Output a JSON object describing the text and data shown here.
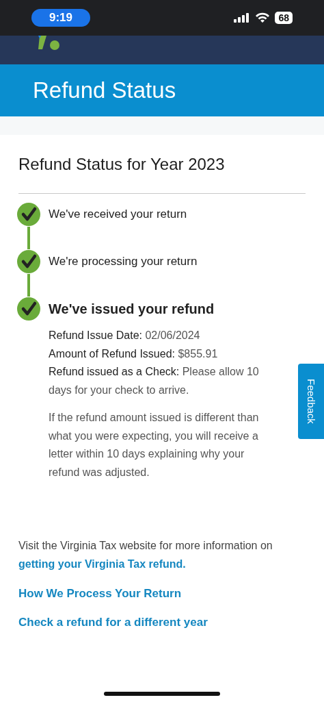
{
  "status_bar": {
    "time": "9:19",
    "battery": "68"
  },
  "page_title": "Refund Status",
  "heading": "Refund Status for Year 2023",
  "steps": [
    {
      "label": "We've received your return",
      "completed": true,
      "current": false
    },
    {
      "label": "We're processing your return",
      "completed": true,
      "current": false
    },
    {
      "label": "We've issued your refund",
      "completed": true,
      "current": true
    }
  ],
  "details": [
    {
      "label": "Refund Issue Date:",
      "value": "02/06/2024"
    },
    {
      "label": "Amount of Refund Issued:",
      "value": "$855.91"
    },
    {
      "label": "Refund issued as a Check:",
      "value": "Please allow 10 days for your check to arrive."
    }
  ],
  "note": "If the refund amount issued is different than what you were expecting, you will receive a letter within 10 days explaining why your refund was adjusted.",
  "info": {
    "text": "Visit the Virginia Tax website for more information on",
    "link": "getting your Virginia Tax refund."
  },
  "links": [
    "How We Process Your Return",
    "Check a refund for a different year"
  ],
  "feedback": "Feedback"
}
